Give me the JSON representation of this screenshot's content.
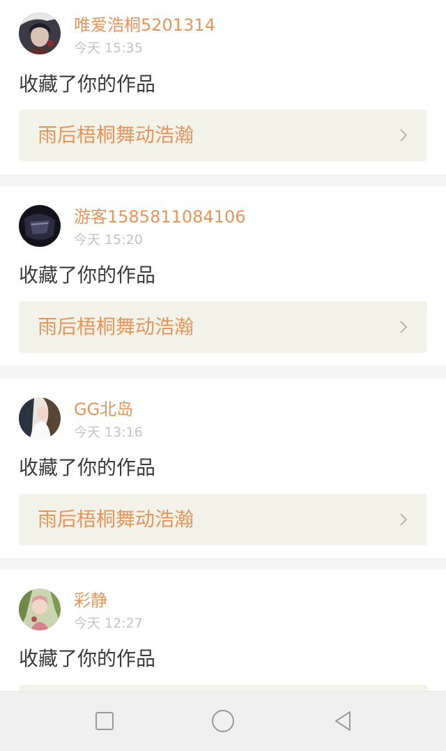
{
  "notifications": [
    {
      "username": "唯爱浩桐5201314",
      "time": "今天 15:35",
      "action": "收藏了你的作品",
      "work_title": "雨后梧桐舞动浩瀚"
    },
    {
      "username": "游客1585811084106",
      "time": "今天 15:20",
      "action": "收藏了你的作品",
      "work_title": "雨后梧桐舞动浩瀚"
    },
    {
      "username": "GG北岛",
      "time": "今天 13:16",
      "action": "收藏了你的作品",
      "work_title": "雨后梧桐舞动浩瀚"
    },
    {
      "username": "彩静",
      "time": "今天 12:27",
      "action": "收藏了你的作品",
      "work_title": ""
    }
  ],
  "colors": {
    "username": "#e9955a",
    "time": "#c4c4c4",
    "action_text": "#3a3a3a",
    "work_card_bg": "#f4f3ea",
    "page_bg": "#f5f5f5"
  },
  "navbar": {
    "icons": [
      "square-icon",
      "circle-home-icon",
      "triangle-back-icon"
    ]
  }
}
